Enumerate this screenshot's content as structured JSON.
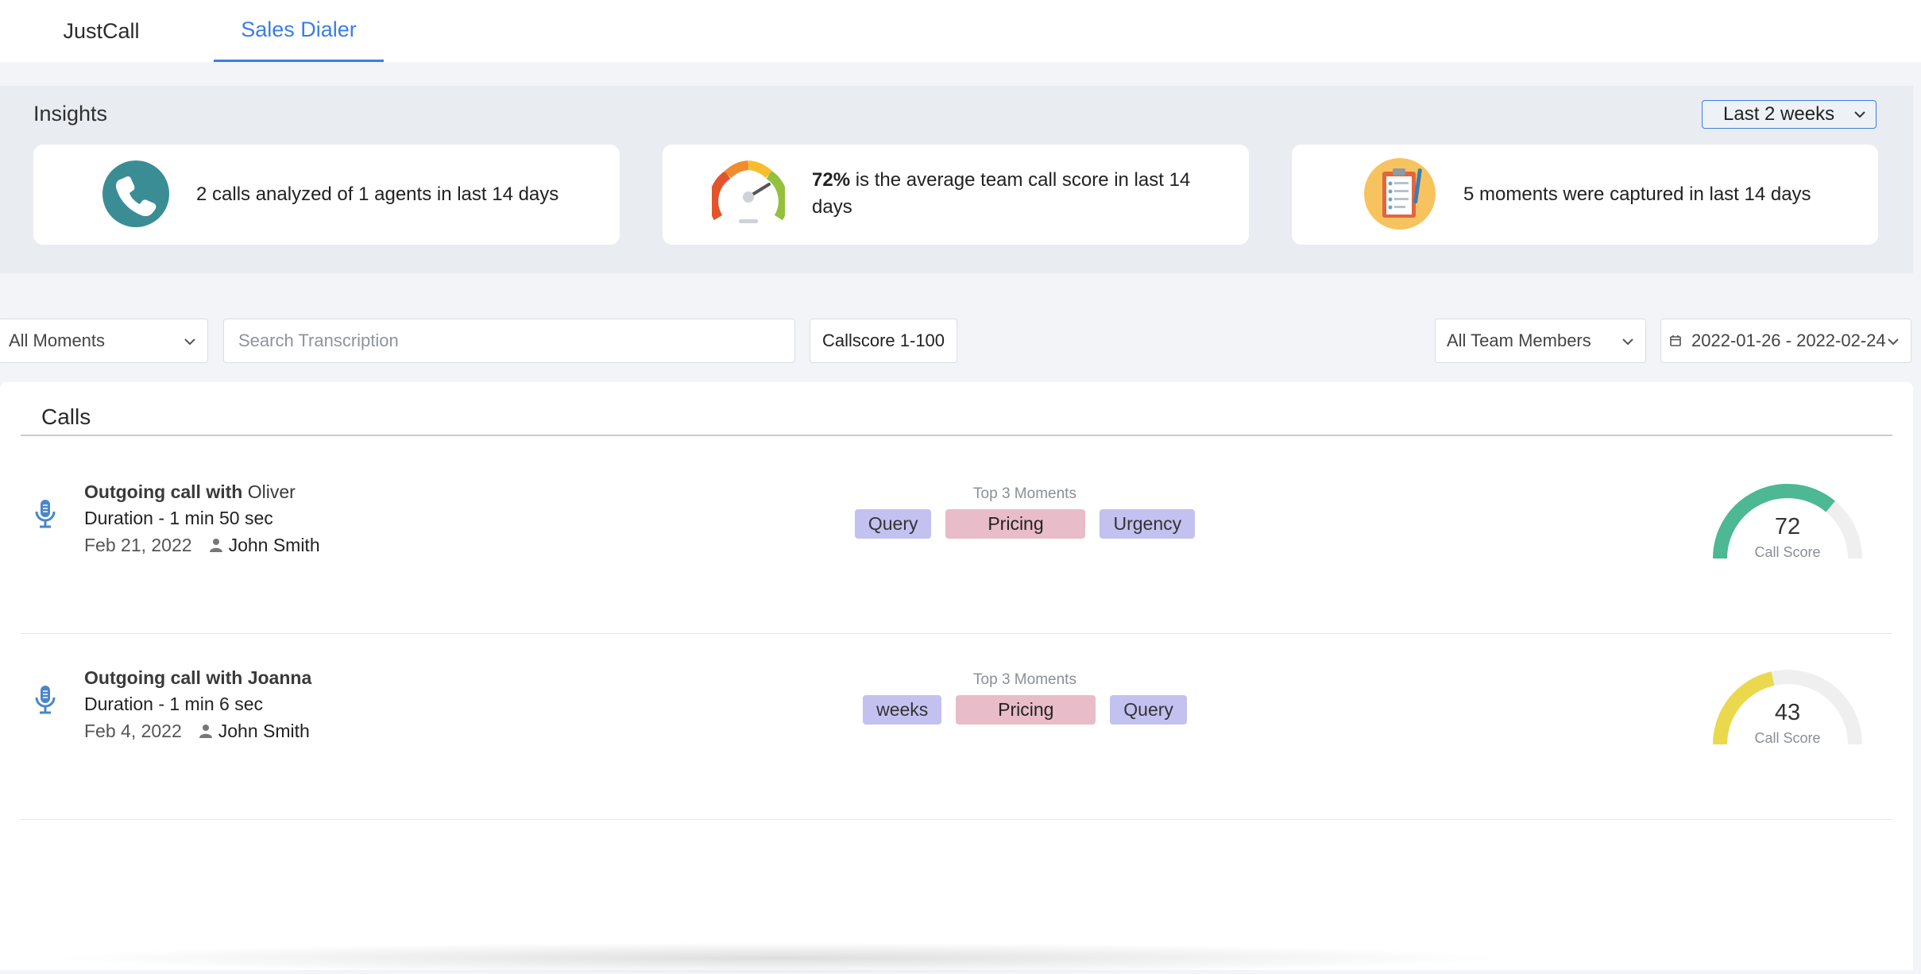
{
  "tabs": [
    {
      "label": "JustCall",
      "active": false
    },
    {
      "label": "Sales Dialer",
      "active": true
    }
  ],
  "insights": {
    "title": "Insights",
    "range_select": {
      "selected": "Last 2 weeks"
    },
    "cards": [
      {
        "icon": "phone-icon",
        "text": "2 calls analyzed of 1 agents in last 14 days"
      },
      {
        "icon": "speedometer-icon",
        "bold": "72%",
        "text": " is the average team call score in last 14 days"
      },
      {
        "icon": "clipboard-icon",
        "text": "5 moments were captured in last 14 days"
      }
    ]
  },
  "filters": {
    "moments": {
      "selected": "All Moments"
    },
    "search": {
      "placeholder": "Search Transcription",
      "value": ""
    },
    "callscore": {
      "label": "Callscore 1-100"
    },
    "team": {
      "selected": "All Team Members"
    },
    "date_range": {
      "value": "2022-01-26 - 2022-02-24",
      "icon": "calendar-icon"
    }
  },
  "calls": {
    "title": "Calls",
    "moments_label": "Top 3 Moments",
    "score_label": "Call Score",
    "items": [
      {
        "title_prefix": "Outgoing call with",
        "contact": "Oliver",
        "duration": "Duration - 1 min 50 sec",
        "date": "Feb 21, 2022",
        "agent": "John Smith",
        "moments": [
          "Query",
          "Pricing",
          "Urgency"
        ],
        "score": 72,
        "score_color": "#4db894"
      },
      {
        "title_prefix": "Outgoing call with",
        "contact": "Joanna",
        "duration": "Duration - 1 min 6 sec",
        "date": "Feb 4, 2022",
        "agent": "John Smith",
        "moments": [
          "weeks",
          "Pricing",
          "Query"
        ],
        "score": 43,
        "score_color": "#ead94c"
      }
    ]
  },
  "colors": {
    "accent": "#3b7de6",
    "chip_purple": "#c3c1ef",
    "chip_pink": "#e8bcc8",
    "gauge_track": "#efefef"
  }
}
